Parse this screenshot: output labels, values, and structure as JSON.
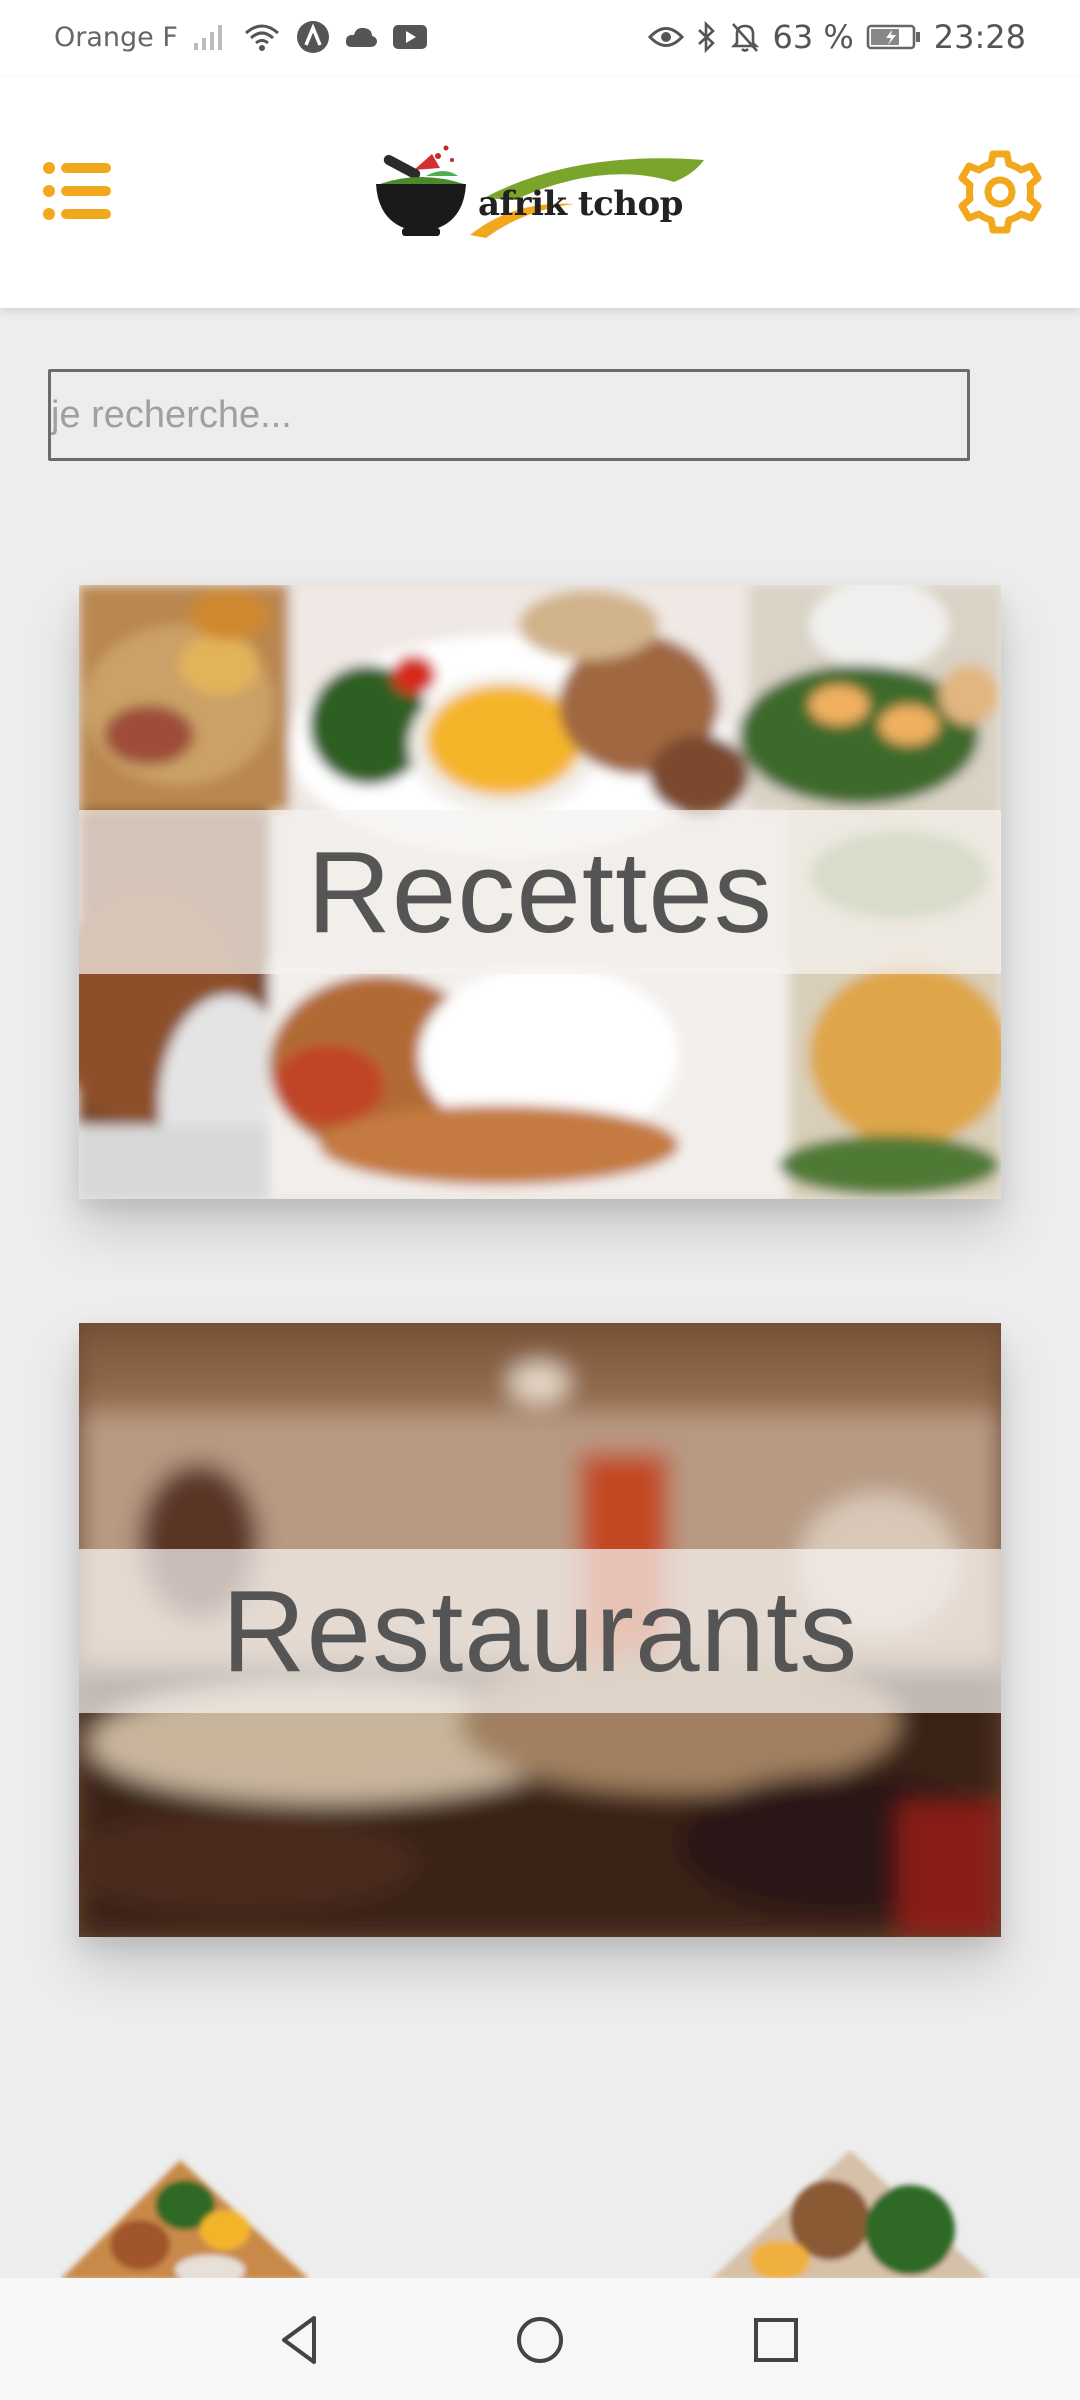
{
  "status_bar": {
    "carrier": "Orange F",
    "battery_percent": "63 %",
    "time": "23:28",
    "icons": [
      "signal-icon",
      "wifi-icon",
      "app-a-icon",
      "cloud-icon",
      "youtube-icon",
      "eye-icon",
      "bluetooth-icon",
      "bell-off-icon",
      "battery-icon"
    ]
  },
  "header": {
    "logo_text": "afrik tchop",
    "menu_icon": "list-menu-icon",
    "settings_icon": "gear-icon",
    "accent_color": "#f2a81d"
  },
  "search": {
    "placeholder": "je recherche...",
    "value": ""
  },
  "cards": [
    {
      "title": "Recettes"
    },
    {
      "title": "Restaurants"
    }
  ],
  "nav_bar": {
    "icons": [
      "back-icon",
      "home-icon",
      "recents-icon"
    ]
  }
}
